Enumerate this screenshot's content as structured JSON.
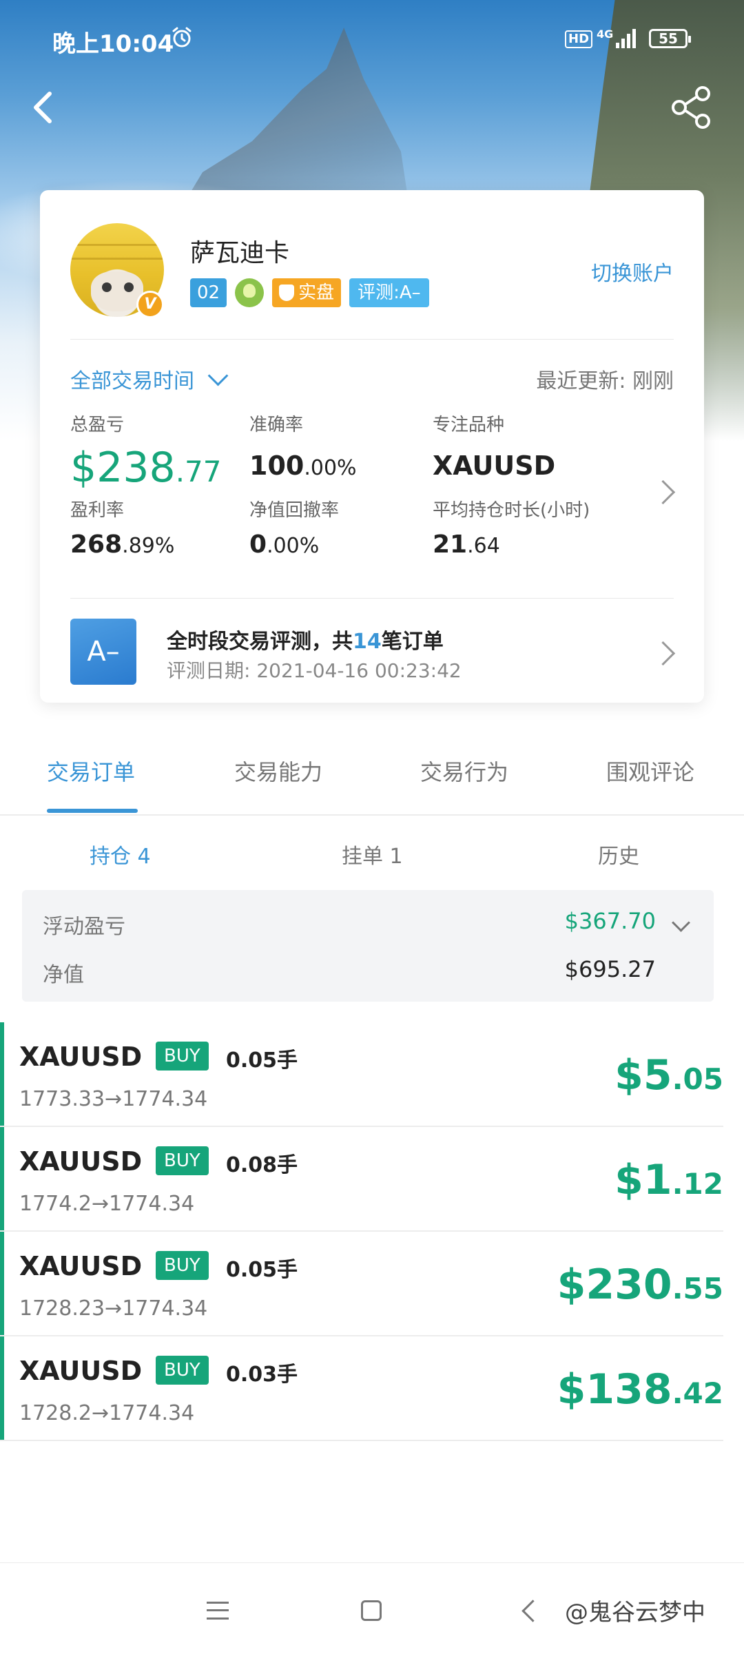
{
  "status_bar": {
    "time": "晚上10:04",
    "hd": "HD",
    "network": "4G",
    "battery": "55"
  },
  "profile": {
    "name": "萨瓦迪卡",
    "level": "02",
    "real_badge": "实盘",
    "eval_badge": "评测:A–",
    "switch_account": "切换账户",
    "time_filter": "全部交易时间",
    "last_update": "最近更新: 刚刚"
  },
  "stats": {
    "total_pnl_label": "总盈亏",
    "total_pnl_main": "$238",
    "total_pnl_dec": ".77",
    "accuracy_label": "准确率",
    "accuracy_main": "100",
    "accuracy_dec": ".00%",
    "focus_label": "专注品种",
    "focus_value": "XAUUSD",
    "profit_rate_label": "盈利率",
    "profit_rate_main": "268",
    "profit_rate_dec": ".89%",
    "drawdown_label": "净值回撤率",
    "drawdown_main": "0",
    "drawdown_dec": ".00%",
    "hold_time_label": "平均持仓时长(小时)",
    "hold_time_main": "21",
    "hold_time_dec": ".64"
  },
  "evaluation": {
    "grade": "A–",
    "title_prefix": "全时段交易评测，共",
    "title_count": "14",
    "title_suffix": "笔订单",
    "date": "评测日期: 2021-04-16 00:23:42"
  },
  "tabs": [
    "交易订单",
    "交易能力",
    "交易行为",
    "围观评论"
  ],
  "subtabs": [
    "持仓 4",
    "挂单 1",
    "历史"
  ],
  "summary": {
    "floating_label": "浮动盈亏",
    "floating_value": "$367.70",
    "equity_label": "净值",
    "equity_value": "$695.27"
  },
  "orders": [
    {
      "symbol": "XAUUSD",
      "side": "BUY",
      "lots": "0.05手",
      "price": "1773.33→1774.34",
      "pnl_main": "$5",
      "pnl_dec": ".05"
    },
    {
      "symbol": "XAUUSD",
      "side": "BUY",
      "lots": "0.08手",
      "price": "1774.2→1774.34",
      "pnl_main": "$1",
      "pnl_dec": ".12"
    },
    {
      "symbol": "XAUUSD",
      "side": "BUY",
      "lots": "0.05手",
      "price": "1728.23→1774.34",
      "pnl_main": "$230",
      "pnl_dec": ".55"
    },
    {
      "symbol": "XAUUSD",
      "side": "BUY",
      "lots": "0.03手",
      "price": "1728.2→1774.34",
      "pnl_main": "$138",
      "pnl_dec": ".42"
    }
  ],
  "watermark": "@鬼谷云梦中",
  "colors": {
    "accent_blue": "#3a95d6",
    "profit_green": "#16a57a",
    "badge_orange": "#f6a623"
  }
}
